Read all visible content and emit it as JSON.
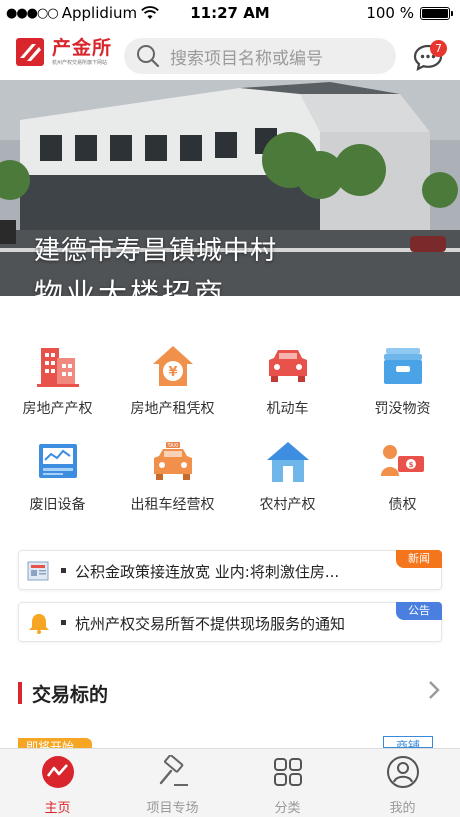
{
  "status_bar": {
    "carrier": "Applidium",
    "time": "11:27 AM",
    "battery": "100 %"
  },
  "header": {
    "logo_name": "产金所",
    "logo_sub": "杭州产权交易所旗下网站",
    "search_placeholder": "搜索项目名称或编号",
    "message_badge": "7"
  },
  "banner": {
    "line1": "建德市寿昌镇城中村",
    "line2": "物业大楼招商"
  },
  "categories": [
    {
      "label": "房地产产权",
      "icon": "building-icon"
    },
    {
      "label": "房地产租凭权",
      "icon": "house-yuan-icon"
    },
    {
      "label": "机动车",
      "icon": "car-icon"
    },
    {
      "label": "罚没物资",
      "icon": "box-icon"
    },
    {
      "label": "废旧设备",
      "icon": "monitor-icon"
    },
    {
      "label": "出租车经营权",
      "icon": "taxi-icon"
    },
    {
      "label": "农村产权",
      "icon": "home-icon"
    },
    {
      "label": "债权",
      "icon": "debt-icon"
    }
  ],
  "notices": [
    {
      "text": "公积金政策接连放宽 业内:将刺激住房...",
      "tag": "新闻",
      "tag_color": "#f5751d",
      "icon": "newspaper-icon"
    },
    {
      "text": "杭州产权交易所暂不提供现场服务的通知",
      "tag": "公告",
      "tag_color": "#4a7fe0",
      "icon": "bell-icon"
    }
  ],
  "section": {
    "title": "交易标的",
    "peek_left": "即将开始",
    "peek_right": "商铺"
  },
  "tabbar": [
    {
      "label": "主页",
      "icon": "home-tab-icon",
      "active": true
    },
    {
      "label": "项目专场",
      "icon": "gavel-icon",
      "active": false
    },
    {
      "label": "分类",
      "icon": "grid-icon",
      "active": false
    },
    {
      "label": "我的",
      "icon": "user-icon",
      "active": false
    }
  ],
  "colors": {
    "brand_red": "#d8262c",
    "inactive_gray": "#999999"
  }
}
